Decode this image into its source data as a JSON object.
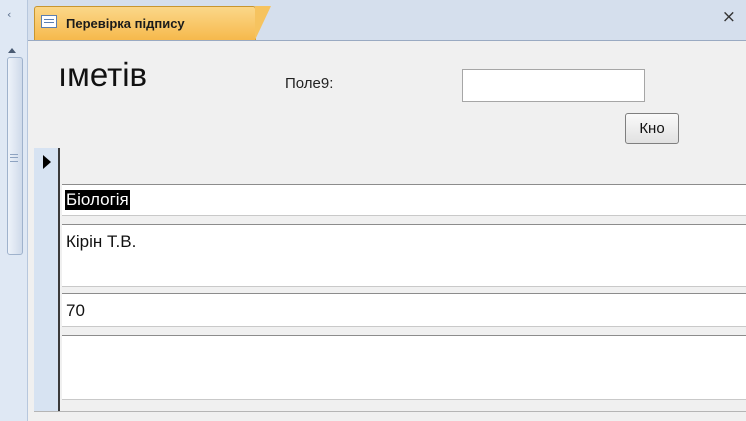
{
  "document_tab": {
    "title": "Перевірка підпису",
    "icon": "form-icon",
    "close_symbol": "×"
  },
  "nav_pane": {
    "collapse_symbol": "‹"
  },
  "form_header": {
    "title": "ıметів",
    "field_label": "Поле9:",
    "field_value": "",
    "button_label": "Кно"
  },
  "record": {
    "subject": "Біологія",
    "teacher": "Кірін Т.В.",
    "grade": "70",
    "extra": ""
  }
}
